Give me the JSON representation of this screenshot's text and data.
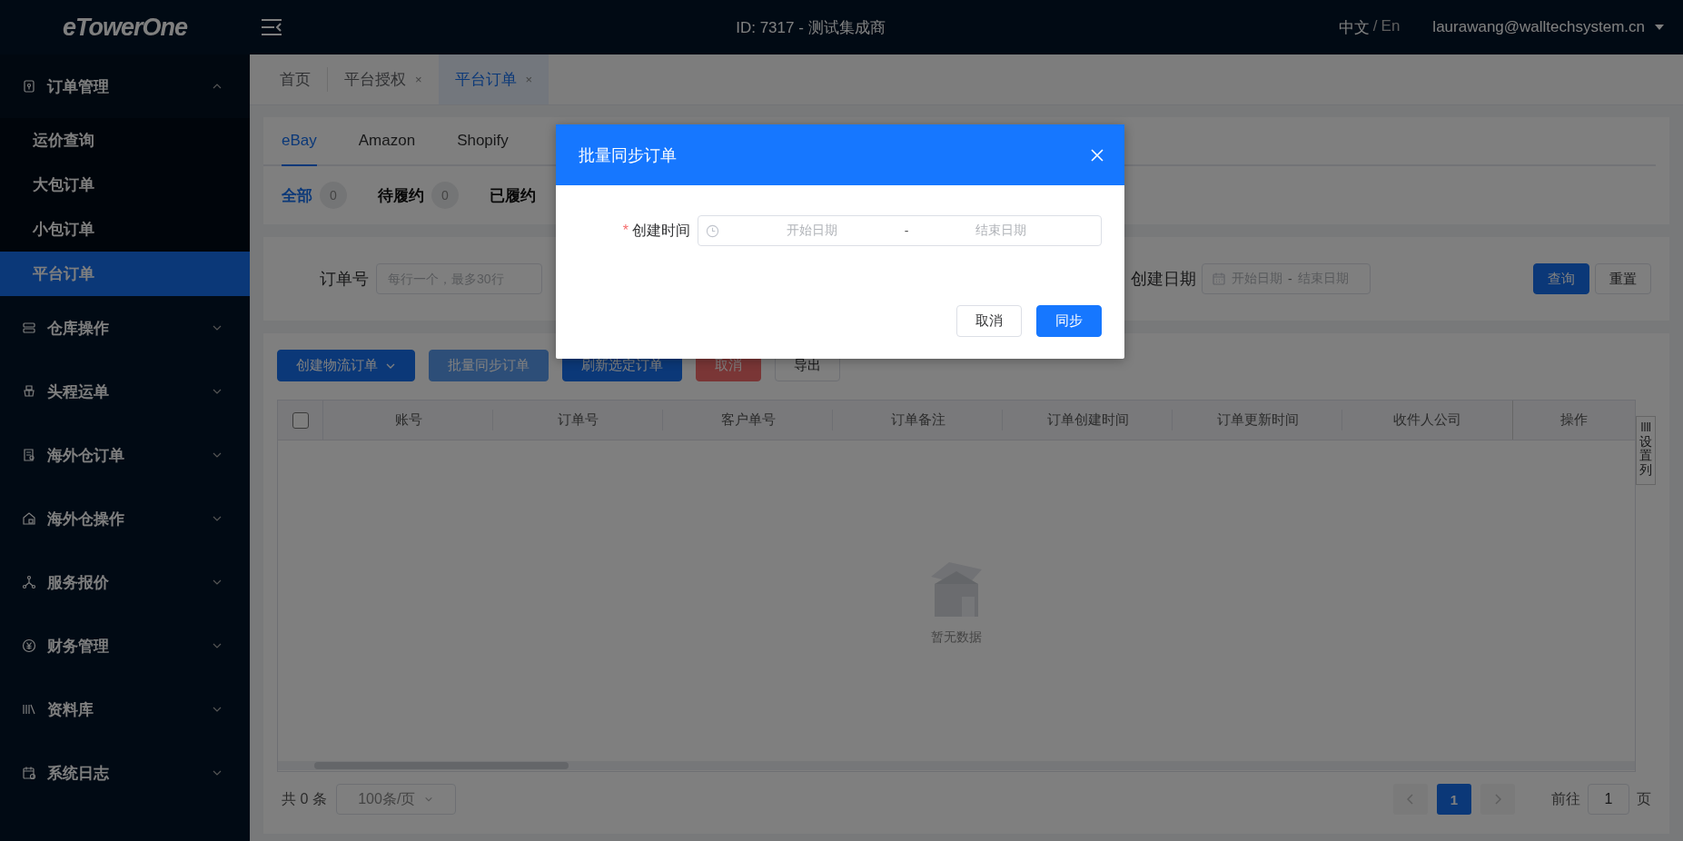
{
  "header": {
    "logo": "eTowerOne",
    "title": "ID: 7317 - 测试集成商",
    "language": {
      "current": "中文",
      "separator": "/",
      "other": "En"
    },
    "user": "laurawang@walltechsystem.cn"
  },
  "sidebar": {
    "items": [
      {
        "label": "订单管理",
        "expanded": true,
        "children": [
          {
            "label": "运价查询",
            "selected": false
          },
          {
            "label": "大包订单",
            "selected": false
          },
          {
            "label": "小包订单",
            "selected": false
          },
          {
            "label": "平台订单",
            "selected": true
          }
        ]
      },
      {
        "label": "仓库操作",
        "expanded": false
      },
      {
        "label": "头程运单",
        "expanded": false
      },
      {
        "label": "海外仓订单",
        "expanded": false
      },
      {
        "label": "海外仓操作",
        "expanded": false
      },
      {
        "label": "服务报价",
        "expanded": false
      },
      {
        "label": "财务管理",
        "expanded": false
      },
      {
        "label": "资料库",
        "expanded": false
      },
      {
        "label": "系统日志",
        "expanded": false
      }
    ]
  },
  "page_tabs": [
    {
      "label": "首页",
      "selected": false
    },
    {
      "label": "平台授权",
      "selected": false,
      "close": "×"
    },
    {
      "label": "平台订单",
      "selected": true,
      "close": "×"
    }
  ],
  "platform_tabs": [
    {
      "label": "eBay",
      "selected": true
    },
    {
      "label": "Amazon",
      "selected": false
    },
    {
      "label": "Shopify",
      "selected": false
    }
  ],
  "status_tabs": [
    {
      "label": "全部",
      "count": "0",
      "selected": true
    },
    {
      "label": "待履约",
      "count": "0",
      "selected": false
    },
    {
      "label": "已履约",
      "selected": false
    }
  ],
  "filters": {
    "order_no": {
      "label": "订单号",
      "placeholder": "每行一个，最多30行"
    },
    "created_date": {
      "label": "创建日期",
      "start_placeholder": "开始日期",
      "separator": "-",
      "end_placeholder": "结束日期"
    },
    "buttons": [
      {
        "label": "查询",
        "kind": "primary"
      },
      {
        "label": "重置",
        "kind": "default"
      }
    ]
  },
  "actions": [
    {
      "label": "创建物流订单",
      "kind": "primary",
      "dropdown": true
    },
    {
      "label": "批量同步订单",
      "kind": "light"
    },
    {
      "label": "刷新选定订单",
      "kind": "primary"
    },
    {
      "label": "取消",
      "kind": "danger"
    },
    {
      "label": "导出",
      "kind": "default"
    }
  ],
  "table": {
    "select_all": {
      "checked": false
    },
    "columns": [
      "账号",
      "订单号",
      "客户单号",
      "订单备注",
      "订单创建时间",
      "订单更新时间",
      "收件人公司",
      "操作"
    ],
    "empty_text": "暂无数据",
    "column_settings": "设置列"
  },
  "pagination": {
    "total": "共 0 条",
    "page_size": "100条/页",
    "pages": [
      {
        "label": "1",
        "selected": true
      }
    ],
    "goto_label": "前往",
    "goto_value": "1",
    "goto_suffix": "页"
  },
  "dialog": {
    "title": "批量同步订单",
    "field": {
      "label": "创建时间",
      "required_mark": "*",
      "start_placeholder": "开始日期",
      "separator": "-",
      "end_placeholder": "结束日期"
    },
    "buttons": [
      {
        "label": "取消",
        "kind": "default"
      },
      {
        "label": "同步",
        "kind": "primary"
      }
    ]
  }
}
